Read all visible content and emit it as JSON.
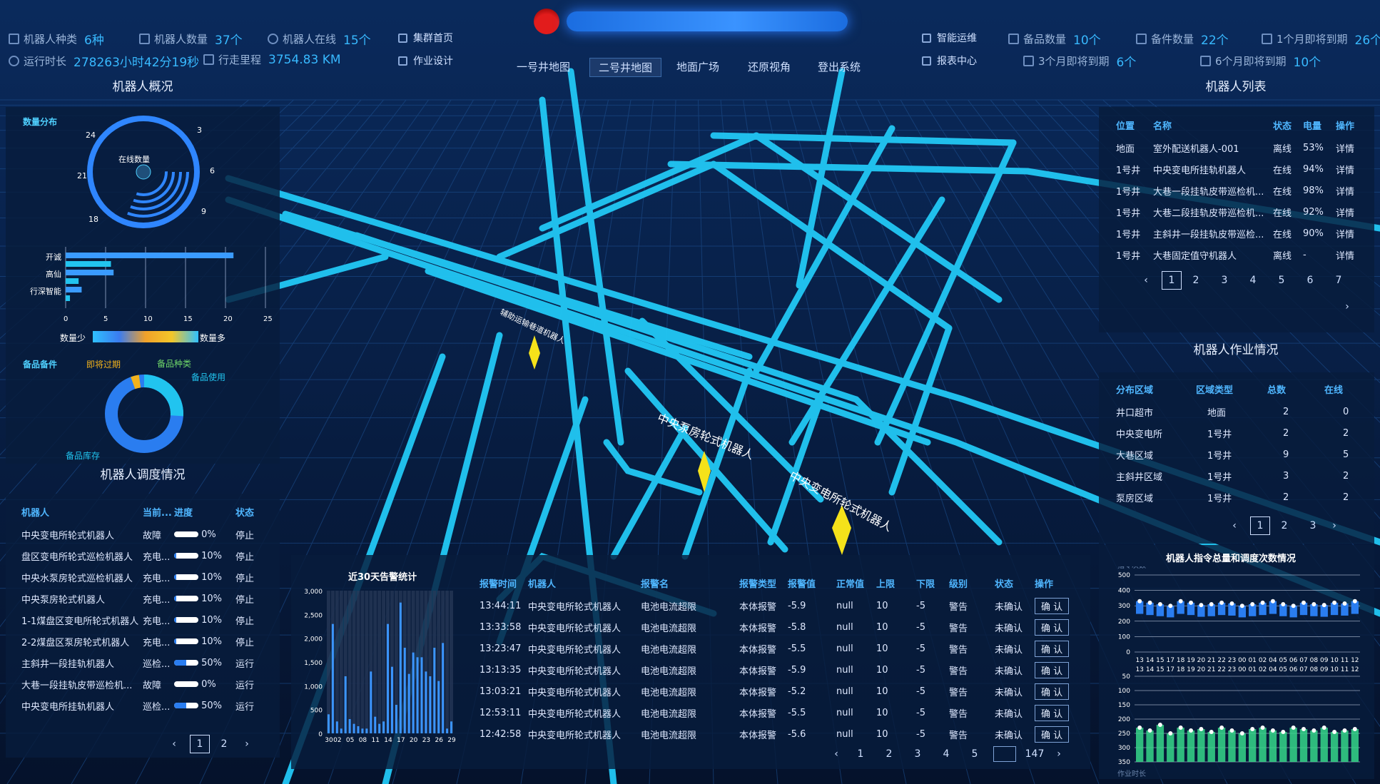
{
  "header": {
    "title": "",
    "stats_left_row1": [
      {
        "label": "机器人种类",
        "value": "6种",
        "icon": "grid-icon"
      },
      {
        "label": "机器人数量",
        "value": "37个",
        "icon": "layers-icon"
      },
      {
        "label": "机器人在线",
        "value": "15个",
        "icon": "globe-icon"
      }
    ],
    "stats_left_row2": [
      {
        "label": "运行时长",
        "value": "278263小时42分19秒",
        "icon": "clock-icon"
      },
      {
        "label": "行走里程",
        "value": "3754.83 KM",
        "icon": "gauge-icon"
      }
    ],
    "nav_left": [
      {
        "label": "集群首页",
        "icon": "edit-icon"
      },
      {
        "label": "作业设计",
        "icon": "edit-icon"
      }
    ],
    "nav_right": [
      {
        "label": "智能运维",
        "icon": "tools-icon"
      },
      {
        "label": "报表中心",
        "icon": "chart-icon"
      }
    ],
    "stats_right_row1": [
      {
        "label": "备品数量",
        "value": "10个",
        "icon": "database-icon"
      },
      {
        "label": "备件数量",
        "value": "22个",
        "icon": "truck-icon"
      },
      {
        "label": "1个月即将到期",
        "value": "26个",
        "icon": "calendar-icon"
      }
    ],
    "stats_right_row2": [
      {
        "label": "3个月即将到期",
        "value": "6个",
        "icon": "calendar-icon"
      },
      {
        "label": "6个月即将到期",
        "value": "10个",
        "icon": "calendar-icon"
      }
    ],
    "tabs": [
      "一号井地图",
      "二号井地图",
      "地面广场",
      "还原视角",
      "登出系统"
    ],
    "active_tab": 1
  },
  "scene_labels": [
    "辅助运输巷道机器人",
    "中央泵房轮式机器人",
    "中央变电所轮式机器人"
  ],
  "overview": {
    "title": "机器人概况",
    "distribution_label": "数量分布",
    "center_label": "在线数量",
    "polar_ticks": [
      "3",
      "6",
      "9",
      "18",
      "21",
      "24"
    ],
    "bar_chart": {
      "categories": [
        "开诚",
        "高仙",
        "行深智能"
      ],
      "values": [
        21,
        6,
        2
      ],
      "xticks": [
        "0",
        "5",
        "10",
        "15",
        "20",
        "25"
      ],
      "xlim": [
        0,
        25
      ]
    },
    "legend_low": "数量少",
    "legend_high": "数量多",
    "spares": {
      "title": "备品备件",
      "expiring": "即将过期",
      "kinds": "备品种类",
      "usage": "备品使用",
      "stock": "备品库存",
      "colors": {
        "expiring": "#f2b21c",
        "kinds": "#6fd86a",
        "usage": "#21c4ef",
        "stock": "#2a7df0"
      }
    }
  },
  "dispatch": {
    "title": "机器人调度情况",
    "headers": [
      "机器人",
      "当前...",
      "进度",
      "状态"
    ],
    "rows": [
      {
        "name": "中央变电所轮式机器人",
        "task": "故障",
        "progress": 0,
        "progress_label": "0%",
        "status": "停止"
      },
      {
        "name": "盘区变电所轮式巡检机器人",
        "task": "充电...",
        "progress": 10,
        "progress_label": "10%",
        "status": "停止"
      },
      {
        "name": "中央水泵房轮式巡检机器人",
        "task": "充电...",
        "progress": 10,
        "progress_label": "10%",
        "status": "停止"
      },
      {
        "name": "中央泵房轮式机器人",
        "task": "充电...",
        "progress": 10,
        "progress_label": "10%",
        "status": "停止"
      },
      {
        "name": "1-1煤盘区变电所轮式机器人",
        "task": "充电...",
        "progress": 10,
        "progress_label": "10%",
        "status": "停止"
      },
      {
        "name": "2-2煤盘区泵房轮式机器人",
        "task": "充电...",
        "progress": 10,
        "progress_label": "10%",
        "status": "停止"
      },
      {
        "name": "主斜井一段挂轨机器人",
        "task": "巡检...",
        "progress": 50,
        "progress_label": "50%",
        "status": "运行"
      },
      {
        "name": "大巷一段挂轨皮带巡检机...",
        "task": "故障",
        "progress": 0,
        "progress_label": "0%",
        "status": "运行"
      },
      {
        "name": "中央变电所挂轨机器人",
        "task": "巡检...",
        "progress": 50,
        "progress_label": "50%",
        "status": "运行"
      }
    ],
    "pages": [
      "1",
      "2"
    ]
  },
  "alarms": {
    "chart_title": "近30天告警统计",
    "table_headers": [
      "报警时间",
      "机器人",
      "报警名",
      "报警类型",
      "报警值",
      "正常值",
      "上限",
      "下限",
      "级别",
      "状态",
      "操作"
    ],
    "rows": [
      {
        "time": "13:44:11",
        "robot": "中央变电所轮式机器人",
        "name": "电池电流超限",
        "type": "本体报警",
        "value": "-5.9",
        "normal": "null",
        "upper": "10",
        "lower": "-5",
        "level": "警告",
        "status": "未确认",
        "action": "确 认"
      },
      {
        "time": "13:33:58",
        "robot": "中央变电所轮式机器人",
        "name": "电池电流超限",
        "type": "本体报警",
        "value": "-5.8",
        "normal": "null",
        "upper": "10",
        "lower": "-5",
        "level": "警告",
        "status": "未确认",
        "action": "确 认"
      },
      {
        "time": "13:23:47",
        "robot": "中央变电所轮式机器人",
        "name": "电池电流超限",
        "type": "本体报警",
        "value": "-5.5",
        "normal": "null",
        "upper": "10",
        "lower": "-5",
        "level": "警告",
        "status": "未确认",
        "action": "确 认"
      },
      {
        "time": "13:13:35",
        "robot": "中央变电所轮式机器人",
        "name": "电池电流超限",
        "type": "本体报警",
        "value": "-5.9",
        "normal": "null",
        "upper": "10",
        "lower": "-5",
        "level": "警告",
        "status": "未确认",
        "action": "确 认"
      },
      {
        "time": "13:03:21",
        "robot": "中央变电所轮式机器人",
        "name": "电池电流超限",
        "type": "本体报警",
        "value": "-5.2",
        "normal": "null",
        "upper": "10",
        "lower": "-5",
        "level": "警告",
        "status": "未确认",
        "action": "确 认"
      },
      {
        "time": "12:53:11",
        "robot": "中央变电所轮式机器人",
        "name": "电池电流超限",
        "type": "本体报警",
        "value": "-5.5",
        "normal": "null",
        "upper": "10",
        "lower": "-5",
        "level": "警告",
        "status": "未确认",
        "action": "确 认"
      },
      {
        "time": "12:42:58",
        "robot": "中央变电所轮式机器人",
        "name": "电池电流超限",
        "type": "本体报警",
        "value": "-5.6",
        "normal": "null",
        "upper": "10",
        "lower": "-5",
        "level": "警告",
        "status": "未确认",
        "action": "确 认"
      }
    ],
    "pages": [
      "1",
      "2",
      "3",
      "4",
      "5",
      "147"
    ]
  },
  "robot_list": {
    "title": "机器人列表",
    "headers": [
      "位置",
      "名称",
      "状态",
      "电量",
      "操作"
    ],
    "rows": [
      {
        "loc": "地面",
        "name": "室外配送机器人-001",
        "status": "离线",
        "power": "53%",
        "op": "详情"
      },
      {
        "loc": "1号井",
        "name": "中央变电所挂轨机器人",
        "status": "在线",
        "power": "94%",
        "op": "详情"
      },
      {
        "loc": "1号井",
        "name": "大巷一段挂轨皮带巡检机...",
        "status": "在线",
        "power": "98%",
        "op": "详情"
      },
      {
        "loc": "1号井",
        "name": "大巷二段挂轨皮带巡检机...",
        "status": "在线",
        "power": "92%",
        "op": "详情"
      },
      {
        "loc": "1号井",
        "name": "主斜井一段挂轨皮带巡检...",
        "status": "在线",
        "power": "90%",
        "op": "详情"
      },
      {
        "loc": "1号井",
        "name": "大巷固定值守机器人",
        "status": "离线",
        "power": "-",
        "op": "详情"
      }
    ],
    "pages": [
      "1",
      "2",
      "3",
      "4",
      "5",
      "6",
      "7"
    ]
  },
  "work": {
    "title": "机器人作业情况",
    "headers": [
      "分布区域",
      "区域类型",
      "总数",
      "在线"
    ],
    "rows": [
      {
        "area": "井口超市",
        "type": "地面",
        "total": "2",
        "online": "0"
      },
      {
        "area": "中央变电所",
        "type": "1号井",
        "total": "2",
        "online": "2"
      },
      {
        "area": "大巷区域",
        "type": "1号井",
        "total": "9",
        "online": "5"
      },
      {
        "area": "主斜井区域",
        "type": "1号井",
        "total": "3",
        "online": "2"
      },
      {
        "area": "泵房区域",
        "type": "1号井",
        "total": "2",
        "online": "2"
      }
    ],
    "pages": [
      "1",
      "2",
      "3"
    ]
  },
  "colors": {
    "accent": "#38b9ff",
    "header_blue": "#4fb6ff",
    "panel": "#071c3c",
    "alarm_bar": "#2f86ff",
    "green": "#36d78a"
  },
  "chart_data": [
    {
      "type": "bar",
      "title": "近30天告警统计",
      "x": [
        "30",
        "01",
        "02",
        "03",
        "04",
        "05",
        "06",
        "07",
        "08",
        "09",
        "10",
        "11",
        "12",
        "13",
        "14",
        "15",
        "16",
        "17",
        "18",
        "19",
        "20",
        "21",
        "22",
        "23",
        "24",
        "25",
        "26",
        "27",
        "28",
        "29"
      ],
      "xtick_labels": [
        "30",
        "02",
        "05",
        "08",
        "11",
        "14",
        "17",
        "20",
        "23",
        "26",
        "29"
      ],
      "values": [
        400,
        2300,
        250,
        100,
        1200,
        300,
        200,
        150,
        100,
        100,
        1300,
        350,
        200,
        250,
        2300,
        1400,
        600,
        2750,
        1800,
        1250,
        1700,
        1600,
        1600,
        1300,
        1200,
        1800,
        1100,
        1900,
        100,
        250
      ],
      "ylim": [
        0,
        3000
      ],
      "yticks": [
        "0",
        "500",
        "1,000",
        "1,500",
        "2,000",
        "2,500",
        "3,000"
      ]
    },
    {
      "type": "bar",
      "title": "机器人指令总量和调度次数情况",
      "ylabel_top": "指令次数",
      "ylabel_bottom": "作业时长",
      "x": [
        "13",
        "14",
        "15",
        "17",
        "18",
        "19",
        "20",
        "21",
        "22",
        "23",
        "00",
        "01",
        "02",
        "04",
        "05",
        "06",
        "07",
        "08",
        "09",
        "10",
        "11",
        "12"
      ],
      "series": [
        {
          "values": [
            330,
            320,
            310,
            300,
            330,
            320,
            305,
            310,
            320,
            315,
            300,
            310,
            320,
            330,
            310,
            300,
            320,
            310,
            305,
            320,
            315,
            330
          ]
        },
        {
          "values": [
            230,
            240,
            220,
            250,
            230,
            240,
            235,
            245,
            230,
            240,
            250,
            235,
            230,
            240,
            245,
            230,
            235,
            240,
            230,
            245,
            240,
            235
          ]
        }
      ],
      "yticks_top": [
        "0",
        "100",
        "200",
        "300",
        "400",
        "500"
      ],
      "yticks_bottom": [
        "50",
        "100",
        "150",
        "200",
        "250",
        "300",
        "350"
      ]
    }
  ]
}
